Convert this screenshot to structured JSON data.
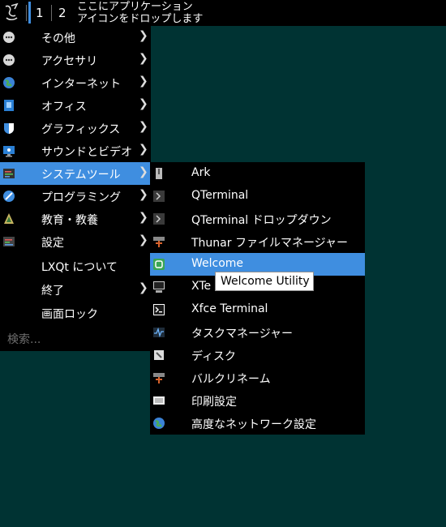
{
  "taskbar": {
    "desktop_1": "1",
    "desktop_2": "2",
    "quicklaunch_line1": "ここにアプリケーション",
    "quicklaunch_line2": "アイコンをドロップします"
  },
  "main_menu": {
    "items": [
      {
        "label": "その他",
        "icon": "misc-icon",
        "submenu": true
      },
      {
        "label": "アクセサリ",
        "icon": "accessories-icon",
        "submenu": true
      },
      {
        "label": "インターネット",
        "icon": "globe-icon",
        "submenu": true
      },
      {
        "label": "オフィス",
        "icon": "office-icon",
        "submenu": true
      },
      {
        "label": "グラフィックス",
        "icon": "graphics-icon",
        "submenu": true
      },
      {
        "label": "サウンドとビデオ",
        "icon": "multimedia-icon",
        "submenu": true
      },
      {
        "label": "システムツール",
        "icon": "system-tools-icon",
        "submenu": true,
        "active": true
      },
      {
        "label": "プログラミング",
        "icon": "programming-icon",
        "submenu": true
      },
      {
        "label": "教育・教養",
        "icon": "education-icon",
        "submenu": true
      },
      {
        "label": "設定",
        "icon": "settings-icon",
        "submenu": true
      },
      {
        "label": "LXQt について",
        "icon": "",
        "submenu": false
      },
      {
        "label": "終了",
        "icon": "",
        "submenu": true
      },
      {
        "label": "画面ロック",
        "icon": "",
        "submenu": false
      }
    ],
    "search_placeholder": "検索..."
  },
  "sub_menu": {
    "items": [
      {
        "label": "Ark",
        "icon": "archive-icon"
      },
      {
        "label": "QTerminal",
        "icon": "terminal-icon"
      },
      {
        "label": "QTerminal ドロップダウン",
        "icon": "terminal-dropdown-icon"
      },
      {
        "label": "Thunar ファイルマネージャー",
        "icon": "file-manager-icon"
      },
      {
        "label": "Welcome",
        "icon": "welcome-icon",
        "active": true
      },
      {
        "label": "XTe",
        "icon": "xterm-icon"
      },
      {
        "label": "Xfce Terminal",
        "icon": "xfce-terminal-icon"
      },
      {
        "label": "タスクマネージャー",
        "icon": "task-manager-icon"
      },
      {
        "label": "ディスク",
        "icon": "disk-icon"
      },
      {
        "label": "バルクリネーム",
        "icon": "bulk-rename-icon"
      },
      {
        "label": "印刷設定",
        "icon": "printer-icon"
      },
      {
        "label": "高度なネットワーク設定",
        "icon": "network-icon"
      }
    ]
  },
  "tooltip": {
    "text": "Welcome Utility"
  },
  "colors": {
    "accent": "#3f8ee0",
    "desktop": "#003333",
    "menu_bg": "#000000"
  }
}
